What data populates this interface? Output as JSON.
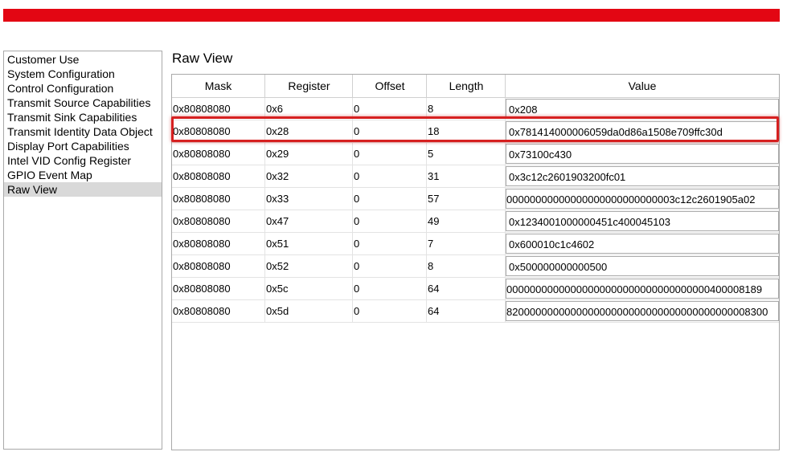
{
  "sidebar": {
    "items": [
      {
        "label": "Customer Use"
      },
      {
        "label": "System Configuration"
      },
      {
        "label": "Control Configuration"
      },
      {
        "label": "Transmit Source Capabilities"
      },
      {
        "label": "Transmit Sink Capabilities"
      },
      {
        "label": "Transmit Identity Data Object"
      },
      {
        "label": "Display Port Capabilities"
      },
      {
        "label": "Intel VID Config Register"
      },
      {
        "label": "GPIO Event Map"
      },
      {
        "label": "Raw View"
      }
    ],
    "selected_index": 9
  },
  "main": {
    "title": "Raw View",
    "table": {
      "columns": [
        "Mask",
        "Register",
        "Offset",
        "Length",
        "Value"
      ],
      "rows": [
        [
          "0x80808080",
          "0x6",
          "0",
          "8",
          "0x208"
        ],
        [
          "0x80808080",
          "0x28",
          "0",
          "18",
          "0x781414000006059da0d86a1508e709ffc30d"
        ],
        [
          "0x80808080",
          "0x29",
          "0",
          "5",
          "0x73100c430"
        ],
        [
          "0x80808080",
          "0x32",
          "0",
          "31",
          "0x3c12c2601903200fc01"
        ],
        [
          "0x80808080",
          "0x33",
          "0",
          "57",
          "00000000000000000000000000003c12c2601905a02"
        ],
        [
          "0x80808080",
          "0x47",
          "0",
          "49",
          "0x1234001000000451c400045103"
        ],
        [
          "0x80808080",
          "0x51",
          "0",
          "7",
          "0x600010c1c4602"
        ],
        [
          "0x80808080",
          "0x52",
          "0",
          "8",
          "0x500000000000500"
        ],
        [
          "0x80808080",
          "0x5c",
          "0",
          "64",
          "00000000000000000000000000000000000400008189"
        ],
        [
          "0x80808080",
          "0x5d",
          "0",
          "64",
          "820000000000000000000000000000000000000008300"
        ]
      ],
      "highlighted_row": 1
    }
  },
  "colors": {
    "brand_bar": "#e30613",
    "highlight": "#d62020",
    "selected_item": "#d9d9d9"
  }
}
